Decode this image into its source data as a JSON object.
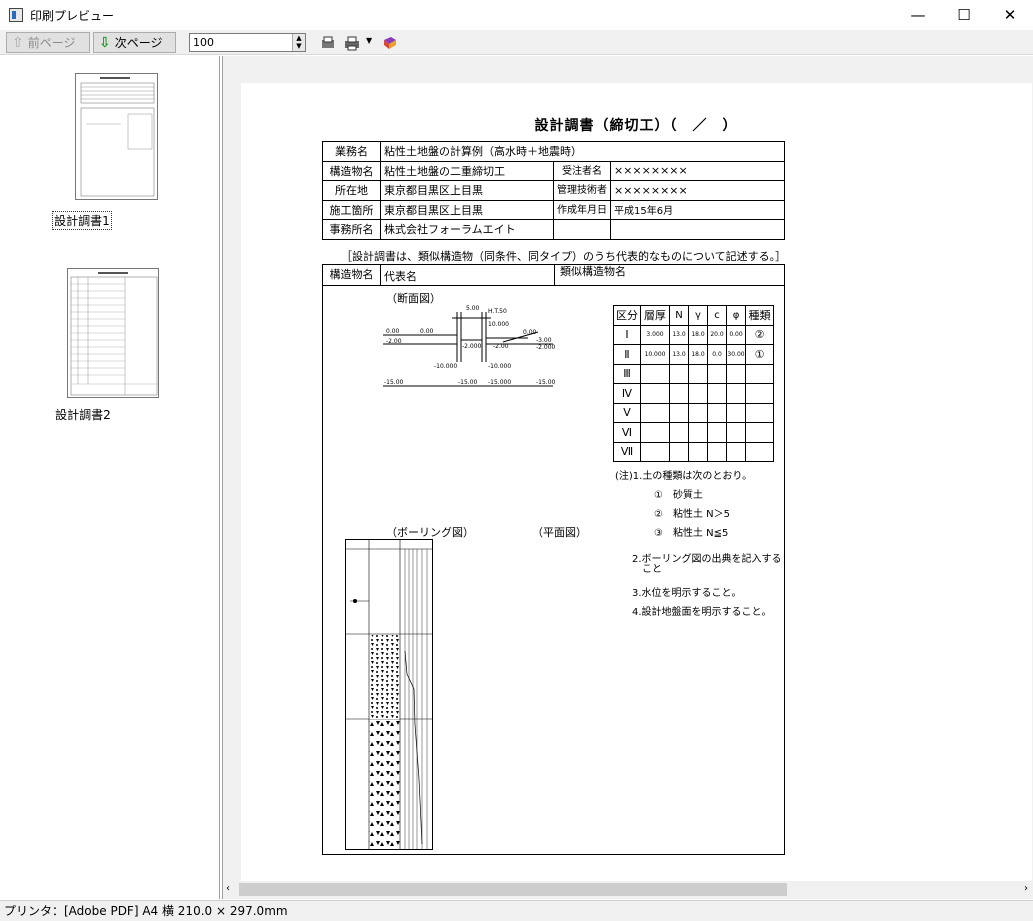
{
  "window": {
    "title": "印刷プレビュー",
    "minimize": "—",
    "maximize": "☐",
    "close": "✕"
  },
  "toolbar": {
    "prev_label": "前ページ",
    "next_label": "次ページ",
    "zoom": "100"
  },
  "thumbnails": [
    {
      "label": "設計調書1"
    },
    {
      "label": "設計調書2"
    }
  ],
  "status": "プリンタ：[Adobe PDF] A4 横  210.0 × 297.0mm",
  "doc": {
    "title": "設計調書（締切工）（　／　）",
    "info": {
      "r1": {
        "label": "業務名",
        "value": "粘性土地盤の計算例（高水時＋地震時）"
      },
      "r2": {
        "label": "構造物名",
        "value": "粘性土地盤の二重締切工",
        "label2": "受注者名",
        "value2": "××××××××"
      },
      "r3": {
        "label": "所在地",
        "value": "東京都目黒区上目黒",
        "label2": "管理技術者",
        "value2": "××××××××"
      },
      "r4": {
        "label": "施工箇所",
        "value": "東京都目黒区上目黒",
        "label2": "作成年月日",
        "value2": "平成15年6月"
      },
      "r5": {
        "label": "事務所名",
        "value": "株式会社フォーラムエイト"
      }
    },
    "note": "［設計調書は、類似構造物（同条件、同タイプ）のうち代表的なものについて記述する。］",
    "body": {
      "struct_label": "構造物名",
      "rep_label": "代表名",
      "similar_label": "類似構造物名",
      "section_label": "（断面図）",
      "boring_label": "（ボーリング図）",
      "plan_label": "（平面図）"
    },
    "soil_table": {
      "headers": [
        "区分",
        "層厚",
        "N",
        "γ",
        "c",
        "φ",
        "種類"
      ],
      "rows": [
        [
          "Ⅰ",
          "3.000",
          "13.0",
          "18.0",
          "20.0",
          "0.00",
          "②"
        ],
        [
          "Ⅱ",
          "10.000",
          "13.0",
          "18.0",
          "0.0",
          "30.00",
          "①"
        ],
        [
          "Ⅲ",
          "",
          "",
          "",
          "",
          "",
          ""
        ],
        [
          "Ⅳ",
          "",
          "",
          "",
          "",
          "",
          ""
        ],
        [
          "Ⅴ",
          "",
          "",
          "",
          "",
          "",
          ""
        ],
        [
          "Ⅵ",
          "",
          "",
          "",
          "",
          "",
          ""
        ],
        [
          "Ⅶ",
          "",
          "",
          "",
          "",
          "",
          ""
        ]
      ]
    },
    "notes": {
      "n1": "(注)1.土の種類は次のとおり。",
      "t1": "①　砂質土",
      "t2": "②　粘性土 N＞5",
      "t3": "③　粘性土 N≦5",
      "n2a": "2.ボーリング図の出典を記入する",
      "n2b": "こと",
      "n3": "3.水位を明示すること。",
      "n4": "4.設計地盤面を明示すること。"
    },
    "section_nums": {
      "w": "5.00",
      "ht": "H.T.50",
      "ten": "10.000",
      "l0": "0.00",
      "l1": "0.00",
      "r0": "0.00",
      "rm": "-2.00",
      "rm2": "-2.000",
      "l2": "-2.00",
      "m2": "-2.000",
      "rr2": "-3.00",
      "b10": "-10.000",
      "b10r": "-10.000",
      "g1": "-15.00",
      "g2": "-15.00",
      "g3": "-15.000",
      "g4": "-15.00"
    }
  },
  "colors": {
    "accent": "#2a6ab8"
  }
}
